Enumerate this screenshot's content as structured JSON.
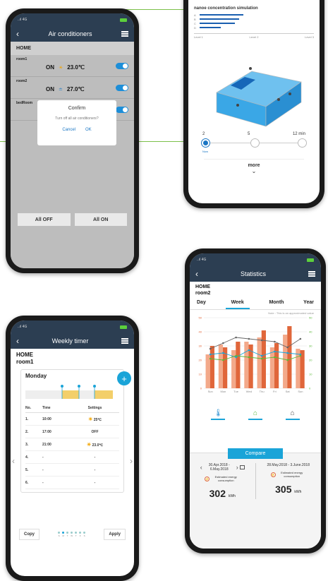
{
  "ac": {
    "nav_title": "Air conditioners",
    "group": "HOME",
    "rooms": [
      {
        "name": "room1",
        "state": "ON",
        "temp": "23.0℃",
        "mode": "sun-icon"
      },
      {
        "name": "room2",
        "state": "ON",
        "temp": "27.0℃",
        "mode": "cool-icon"
      },
      {
        "name": "bedRoom",
        "state": "ON",
        "temp": "",
        "mode": "sun-icon"
      }
    ],
    "dialog": {
      "title": "Confirm",
      "message": "Turn off all air conditioners?",
      "cancel": "Cancel",
      "ok": "OK"
    },
    "all_off": "All OFF",
    "all_on": "All ON"
  },
  "nanoe": {
    "title": "nanoe concentration simulation",
    "rows": [
      "A",
      "B",
      "C",
      "D"
    ],
    "levels": [
      "Level 1",
      "Level 2",
      "Level 3"
    ],
    "slider_labels": [
      "2",
      "5",
      "12 min"
    ],
    "now": "Now",
    "more": "more"
  },
  "timer": {
    "nav_title": "Weekly timer",
    "home": "HOME",
    "room": "room1",
    "day": "Monday",
    "headers": [
      "No.",
      "Time",
      "Settings"
    ],
    "rows": [
      {
        "no": "1.",
        "time": "10:00",
        "setting": "25℃",
        "icon": "sun"
      },
      {
        "no": "2.",
        "time": "17:00",
        "setting": "OFF",
        "icon": ""
      },
      {
        "no": "3.",
        "time": "21:00",
        "setting": "23.0℃",
        "icon": "sun"
      },
      {
        "no": "4.",
        "time": "-",
        "setting": "-",
        "icon": ""
      },
      {
        "no": "5.",
        "time": "-",
        "setting": "-",
        "icon": ""
      },
      {
        "no": "6.",
        "time": "-",
        "setting": "-",
        "icon": ""
      }
    ],
    "copy": "Copy",
    "apply": "Apply",
    "days": [
      "S",
      "M",
      "T",
      "W",
      "T",
      "F",
      "S"
    ]
  },
  "stats": {
    "nav_title": "Statistics",
    "home": "HOME",
    "room": "room2",
    "tabs": [
      "Day",
      "Week",
      "Month",
      "Year"
    ],
    "active_tab": "Week",
    "note": "Note : This is an approximated value",
    "compare": "Compare",
    "left_range": "30.Apr.2018 - 6.May.2018",
    "right_range": "28.May.2018 - 3.June.2018",
    "energy_label": "Estimated energy consumption",
    "left_value": "302",
    "right_value": "305",
    "unit": "kWh",
    "colors": {
      "accent": "#1aa4d8",
      "bar_dark": "#e0663a",
      "bar_light": "#f3a98a"
    }
  },
  "chart_data": {
    "type": "bar",
    "categories": [
      "Sun",
      "Mon",
      "Tue",
      "Wed",
      "Thu",
      "Fri",
      "Sat",
      "Sun"
    ],
    "series": [
      {
        "values": [
          24,
          31,
          27,
          33,
          36,
          29,
          38,
          28
        ]
      },
      {
        "values": [
          30,
          29,
          33,
          31,
          41,
          32,
          44,
          27
        ]
      }
    ],
    "lines": [
      {
        "values": [
          28,
          32,
          36,
          35,
          34,
          33,
          29,
          35
        ]
      },
      {
        "values": [
          24,
          25,
          22,
          27,
          23,
          26,
          25,
          24
        ]
      },
      {
        "values": [
          21,
          20,
          23,
          22,
          21,
          22,
          20,
          23
        ]
      }
    ],
    "ylim": [
      0,
      50
    ],
    "grid": true
  }
}
